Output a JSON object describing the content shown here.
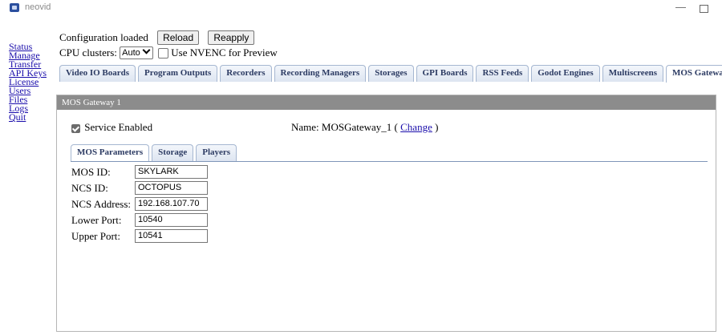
{
  "window": {
    "title": "neovid",
    "minimize_glyph": "—"
  },
  "nav": [
    "Status",
    "Manage",
    "Transfer",
    "API Keys",
    "License",
    "Users",
    "Files",
    "Logs",
    "Quit"
  ],
  "config": {
    "status_text": "Configuration loaded",
    "reload_label": "Reload",
    "reapply_label": "Reapply",
    "cpu_label": "CPU clusters:",
    "cpu_value": "Auto",
    "nvenc_label": "Use NVENC for Preview"
  },
  "tabs": [
    "Video IO Boards",
    "Program Outputs",
    "Recorders",
    "Recording Managers",
    "Storages",
    "GPI Boards",
    "RSS Feeds",
    "Godot Engines",
    "Multiscreens",
    "MOS Gateways"
  ],
  "active_tab": "MOS Gateways",
  "panel": {
    "title": "MOS Gateway 1",
    "service_label": "Service Enabled",
    "name_prefix": "Name:",
    "name_value": "MOSGateway_1",
    "change_label": "Change",
    "paren_open": "(",
    "paren_close": ")",
    "subtabs": [
      "MOS Parameters",
      "Storage",
      "Players"
    ],
    "active_subtab": "MOS Parameters",
    "fields": [
      {
        "label": "MOS ID:",
        "value": "SKYLARK"
      },
      {
        "label": "NCS ID:",
        "value": "OCTOPUS"
      },
      {
        "label": "NCS Address:",
        "value": "192.168.107.70"
      },
      {
        "label": "Lower Port:",
        "value": "10540"
      },
      {
        "label": "Upper Port:",
        "value": "10541"
      }
    ]
  },
  "colors": {
    "link": "#1a0dab",
    "panel_header": "#8c8c8c",
    "tab_text": "#2c3b63"
  }
}
